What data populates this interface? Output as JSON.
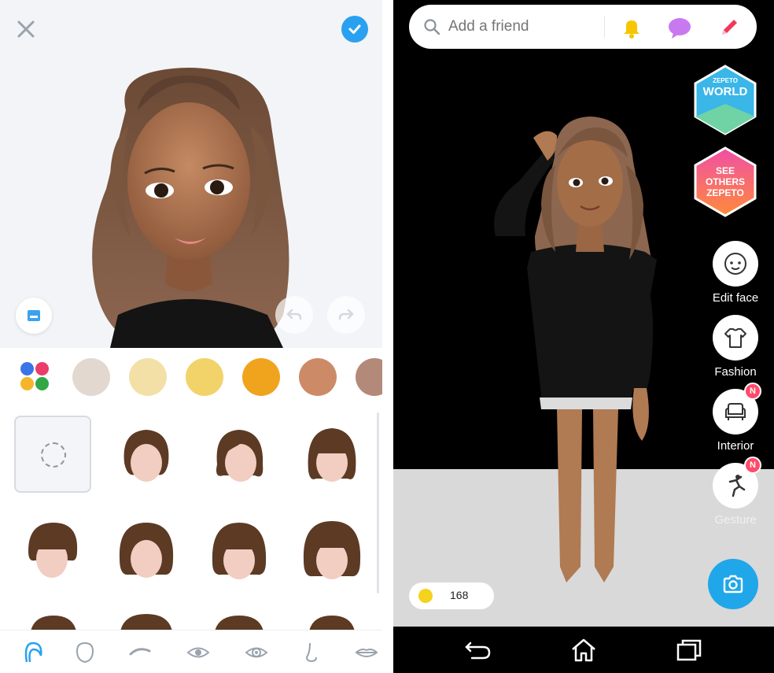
{
  "editor": {
    "swatch_colors": [
      "#e2d8d0",
      "#f2e0a6",
      "#f2d36a",
      "#f0a41d",
      "#cc8b66",
      "#b38a7a"
    ],
    "palette_colors": [
      "#3b74e6",
      "#ea3d6a",
      "#f5b52b",
      "#31a845"
    ],
    "tabs": [
      "hair-icon",
      "face-shape-icon",
      "eyebrow-icon",
      "eye-icon",
      "eye-detail-icon",
      "nose-icon",
      "lips-icon"
    ],
    "hair_color": "#5c3a24",
    "skin_color": "#f1cdc2",
    "accent": "#2aa1f0"
  },
  "home": {
    "search_placeholder": "Add a friend",
    "world_badge": {
      "top": "ZEPETO",
      "main": "WORLD"
    },
    "see_others_badge": {
      "line1": "SEE",
      "line2": "OTHERS",
      "line3": "ZEPETO"
    },
    "side_buttons": [
      {
        "label": "Edit face",
        "icon": "face-icon"
      },
      {
        "label": "Fashion",
        "icon": "shirt-icon"
      },
      {
        "label": "Interior",
        "icon": "armchair-icon",
        "badge": "N"
      },
      {
        "label": "Gesture",
        "icon": "gesture-icon",
        "badge": "N"
      }
    ],
    "coins": "168",
    "accent": "#1fa7ea"
  }
}
